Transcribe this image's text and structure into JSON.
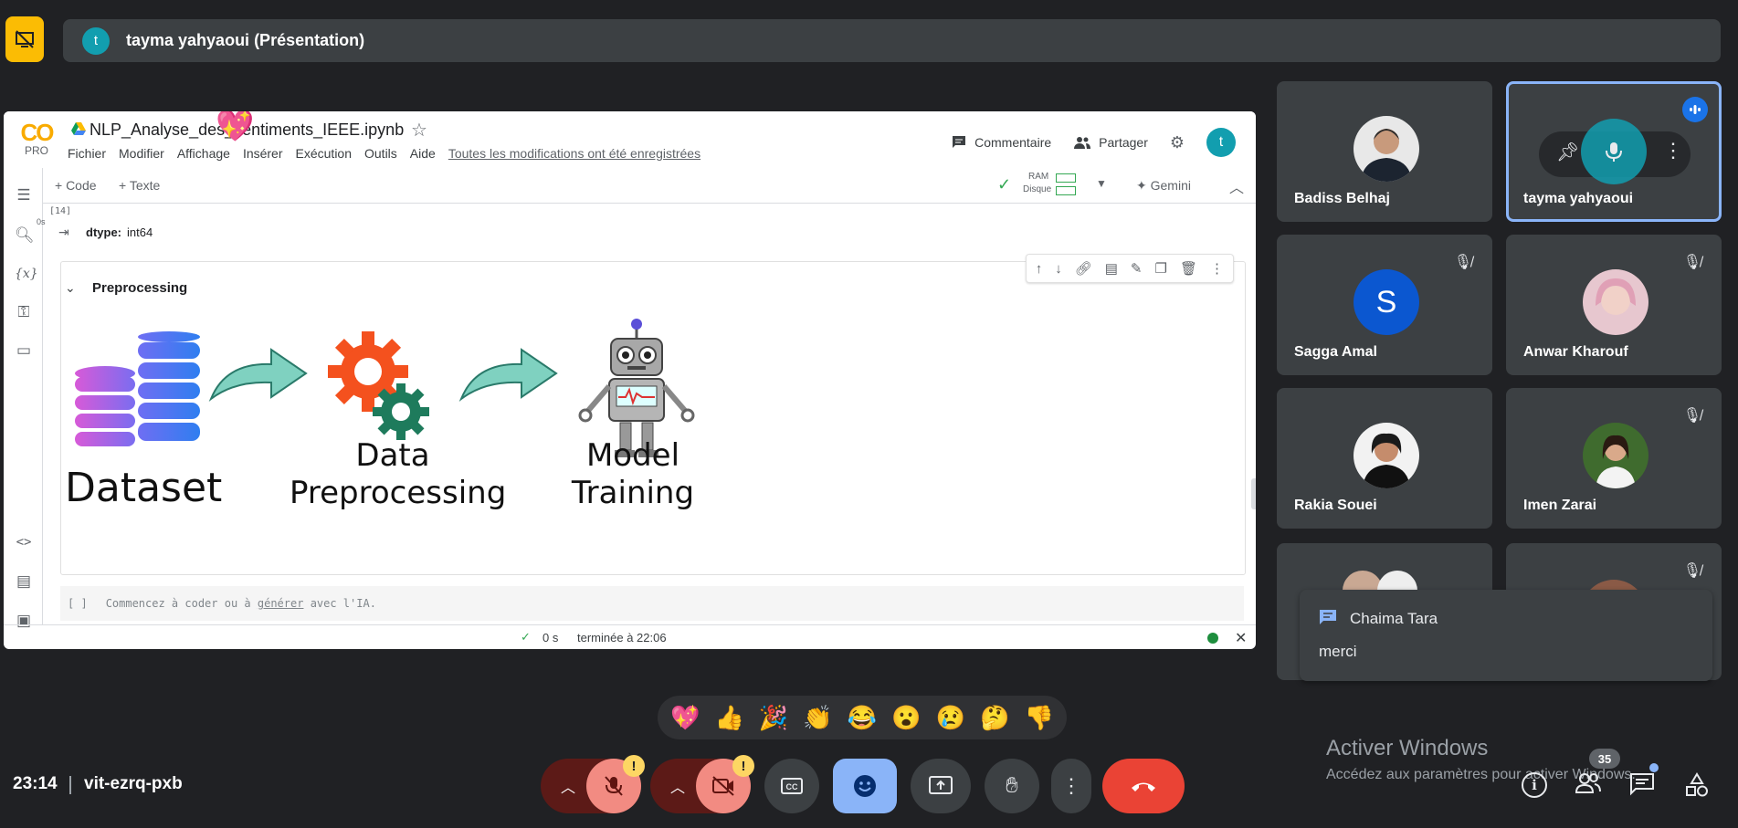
{
  "presentation": {
    "presenter_initial": "t",
    "presenter_label": "tayma yahyaoui (Présentation)"
  },
  "colab": {
    "logo_text": "CO",
    "logo_sub": "PRO",
    "notebook_title": "NLP_Analyse_des_sentiments_IEEE.ipynb",
    "menu": [
      "Fichier",
      "Modifier",
      "Affichage",
      "Insérer",
      "Exécution",
      "Outils",
      "Aide"
    ],
    "saved_status": "Toutes les modifications ont été enregistrées",
    "comment_label": "Commentaire",
    "share_label": "Partager",
    "user_initial": "t",
    "toolbar": {
      "add_code": "+ Code",
      "add_text": "+ Texte",
      "ram_label": "RAM",
      "disk_label": "Disque",
      "gemini_label": "Gemini"
    },
    "prev_cell": {
      "exec_count": "[14]",
      "exec_time": "0s",
      "output": "dtype:",
      "output_value": "int64"
    },
    "section_title": "Preprocessing",
    "diagram": {
      "dataset_label": "Dataset",
      "preprocessing_label_line1": "Data",
      "preprocessing_label_line2": "Preprocessing",
      "training_label_line1": "Model",
      "training_label_line2": "Training"
    },
    "empty_cell": {
      "brackets": "[ ]",
      "prompt_before": "Commencez à coder ou à",
      "prompt_link": "générer",
      "prompt_after": "avec l'IA."
    },
    "status": {
      "duration": "0 s",
      "finished": "terminée à 22:06"
    }
  },
  "participants": [
    {
      "name": "Badiss Belhaj",
      "muted": false
    },
    {
      "name": "tayma yahyaoui",
      "muted": false,
      "speaking": true
    },
    {
      "name": "Sagga Amal",
      "initial": "S",
      "muted": true
    },
    {
      "name": "Anwar Kharouf",
      "muted": true
    },
    {
      "name": "Rakia Souei",
      "muted": false
    },
    {
      "name": "Imen Zarai",
      "muted": true
    }
  ],
  "chat_notification": {
    "sender": "Chaima Tara",
    "message": "merci"
  },
  "reactions": [
    "💖",
    "👍",
    "🎉",
    "👏",
    "😂",
    "😮",
    "😢",
    "🤔",
    "👎"
  ],
  "windows_watermark": {
    "title": "Activer Windows",
    "subtitle": "Accédez aux paramètres pour activer Windows."
  },
  "meeting": {
    "time": "23:14",
    "code": "vit-ezrq-pxb",
    "participant_count": "35"
  },
  "warning_badge": "!"
}
